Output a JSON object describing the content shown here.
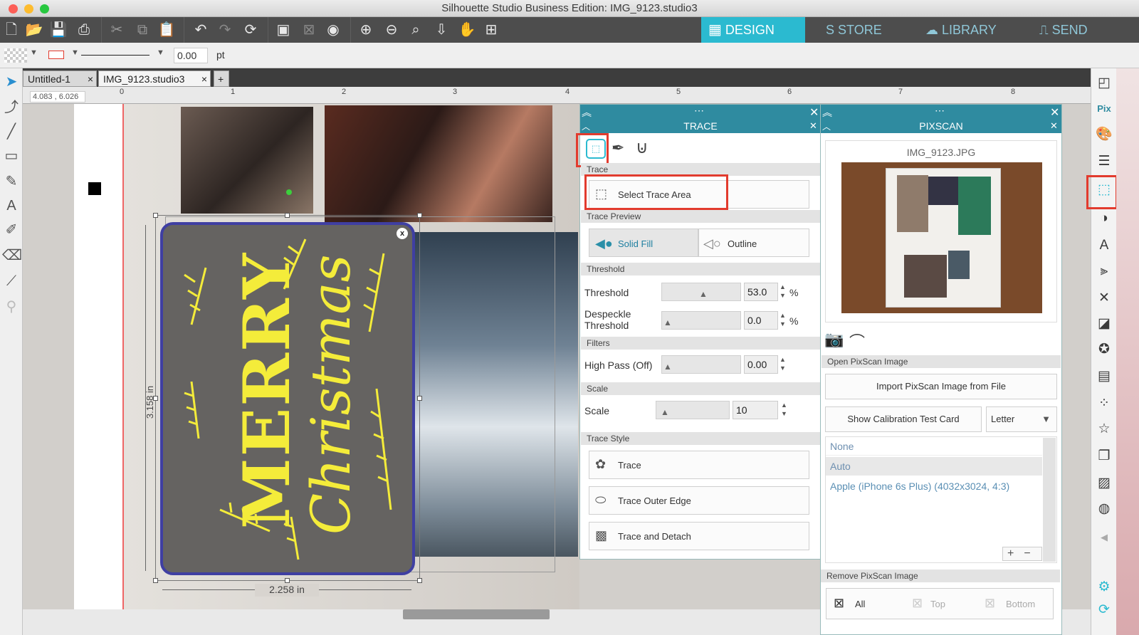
{
  "window": {
    "title": "Silhouette Studio Business Edition: IMG_9123.studio3"
  },
  "nav": {
    "design": "DESIGN",
    "store": "STORE",
    "library": "LIBRARY",
    "send": "SEND"
  },
  "options": {
    "line_width": "0.00",
    "unit": "pt"
  },
  "tabs": [
    {
      "label": "Untitled-1"
    },
    {
      "label": "IMG_9123.studio3"
    }
  ],
  "ruler": {
    "coords": "4.083 , 6.026",
    "ticks": [
      "0",
      "1",
      "2",
      "3",
      "4",
      "5",
      "6",
      "7",
      "8"
    ]
  },
  "canvas": {
    "selection_height": "3.158 in",
    "selection_width": "2.258 in",
    "artwork_text_1": "MERRY",
    "artwork_text_2": "Christmas"
  },
  "trace": {
    "title": "TRACE",
    "section_trace": "Trace",
    "select_area": "Select Trace Area",
    "section_preview": "Trace Preview",
    "solid_fill": "Solid Fill",
    "outline": "Outline",
    "section_threshold": "Threshold",
    "threshold_label": "Threshold",
    "threshold_value": "53.0",
    "threshold_unit": "%",
    "despeckle_label_1": "Despeckle",
    "despeckle_label_2": "Threshold",
    "despeckle_value": "0.0",
    "despeckle_unit": "%",
    "section_filters": "Filters",
    "highpass_label": "High Pass (Off)",
    "highpass_value": "0.00",
    "section_scale": "Scale",
    "scale_label": "Scale",
    "scale_value": "10",
    "section_style": "Trace Style",
    "style_trace": "Trace",
    "style_outer": "Trace Outer Edge",
    "style_detach": "Trace and Detach"
  },
  "pixscan": {
    "title": "PIXSCAN",
    "image_name": "IMG_9123.JPG",
    "open_section": "Open PixScan Image",
    "import_button": "Import PixScan Image from File",
    "calibration_button": "Show Calibration Test Card",
    "paper_size": "Letter",
    "camera_list": [
      "None",
      "Auto",
      "Apple (iPhone 6s Plus) (4032x3024, 4:3)"
    ],
    "remove_section": "Remove PixScan Image",
    "remove_all": "All",
    "remove_top": "Top",
    "remove_bottom": "Bottom"
  },
  "colors": {
    "accent": "#2bbad0",
    "panel_header": "#2f8ba0",
    "highlight": "#e23b2e",
    "artwork_text": "#f4ec3a"
  }
}
